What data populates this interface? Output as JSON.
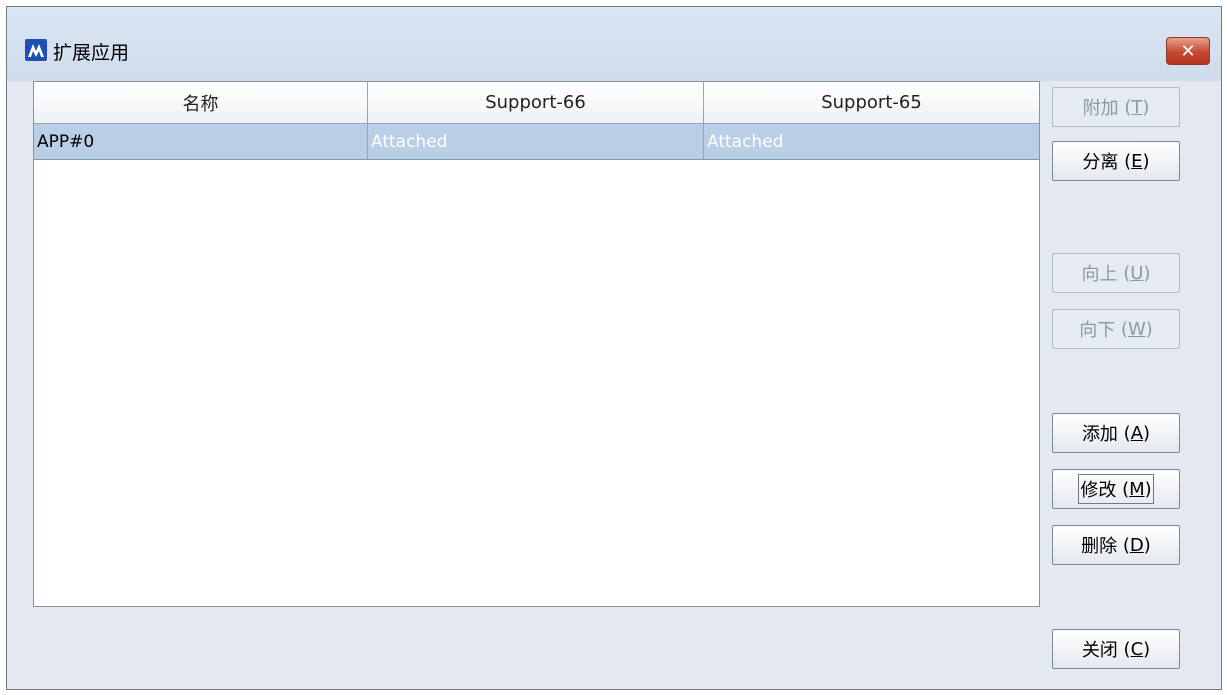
{
  "window": {
    "title": "扩展应用",
    "close_symbol": "✕"
  },
  "table": {
    "columns": [
      "名称",
      "Support-66",
      "Support-65"
    ],
    "rows": [
      {
        "name": "APP#0",
        "support66": "Attached",
        "support65": "Attached"
      }
    ]
  },
  "buttons": {
    "attach": {
      "label": "附加",
      "mnemonic": "T",
      "state": "disabled"
    },
    "detach": {
      "label": "分离",
      "mnemonic": "E",
      "state": "enabled"
    },
    "move_up": {
      "label": "向上",
      "mnemonic": "U",
      "state": "disabled"
    },
    "move_down": {
      "label": "向下",
      "mnemonic": "W",
      "state": "disabled"
    },
    "add": {
      "label": "添加",
      "mnemonic": "A",
      "state": "enabled"
    },
    "modify": {
      "label": "修改",
      "mnemonic": "M",
      "state": "focused"
    },
    "delete": {
      "label": "删除",
      "mnemonic": "D",
      "state": "enabled"
    },
    "close": {
      "label": "关闭",
      "mnemonic": "C",
      "state": "enabled"
    }
  },
  "colors": {
    "window_bg": "#e3e8f1",
    "selected_row": "#b8cfe6",
    "app_icon": "#1f4fb4",
    "close_button": "#c64a32"
  },
  "icons": {
    "app": "app-logo-icon",
    "close": "close-icon"
  }
}
